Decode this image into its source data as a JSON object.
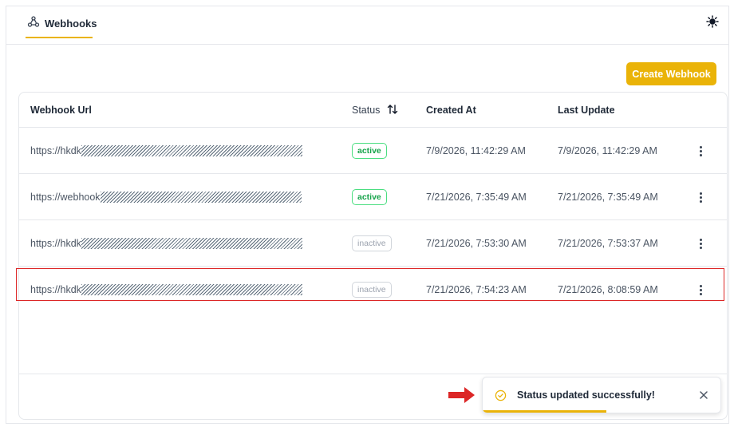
{
  "tabs": [
    {
      "label": "Webhooks",
      "icon": "webhook-icon",
      "active": true
    }
  ],
  "header": {
    "theme_toggle_icon": "sun-icon"
  },
  "toolbar": {
    "create_label": "Create Webhook"
  },
  "table": {
    "columns": {
      "url": "Webhook Url",
      "status": "Status",
      "created": "Created At",
      "updated": "Last Update"
    },
    "rows": [
      {
        "url": "https://hkdk",
        "status": "active",
        "created_at": "7/9/2026, 11:42:29 AM",
        "last_update": "7/9/2026, 11:42:29 AM"
      },
      {
        "url": "https://webhook",
        "status": "active",
        "created_at": "7/21/2026, 7:35:49 AM",
        "last_update": "7/21/2026, 7:35:49 AM"
      },
      {
        "url": "https://hkdk",
        "status": "inactive",
        "created_at": "7/21/2026, 7:53:30 AM",
        "last_update": "7/21/2026, 7:53:37 AM"
      },
      {
        "url": "https://hkdk",
        "status": "inactive",
        "created_at": "7/21/2026, 7:54:23 AM",
        "last_update": "7/21/2026, 8:08:59 AM"
      }
    ]
  },
  "toast": {
    "message": "Status updated successfully!",
    "progress_percent": 52
  },
  "colors": {
    "accent": "#eab308",
    "active": "#16a34a",
    "inactive": "#9ca3af",
    "highlight": "#dc2626"
  }
}
